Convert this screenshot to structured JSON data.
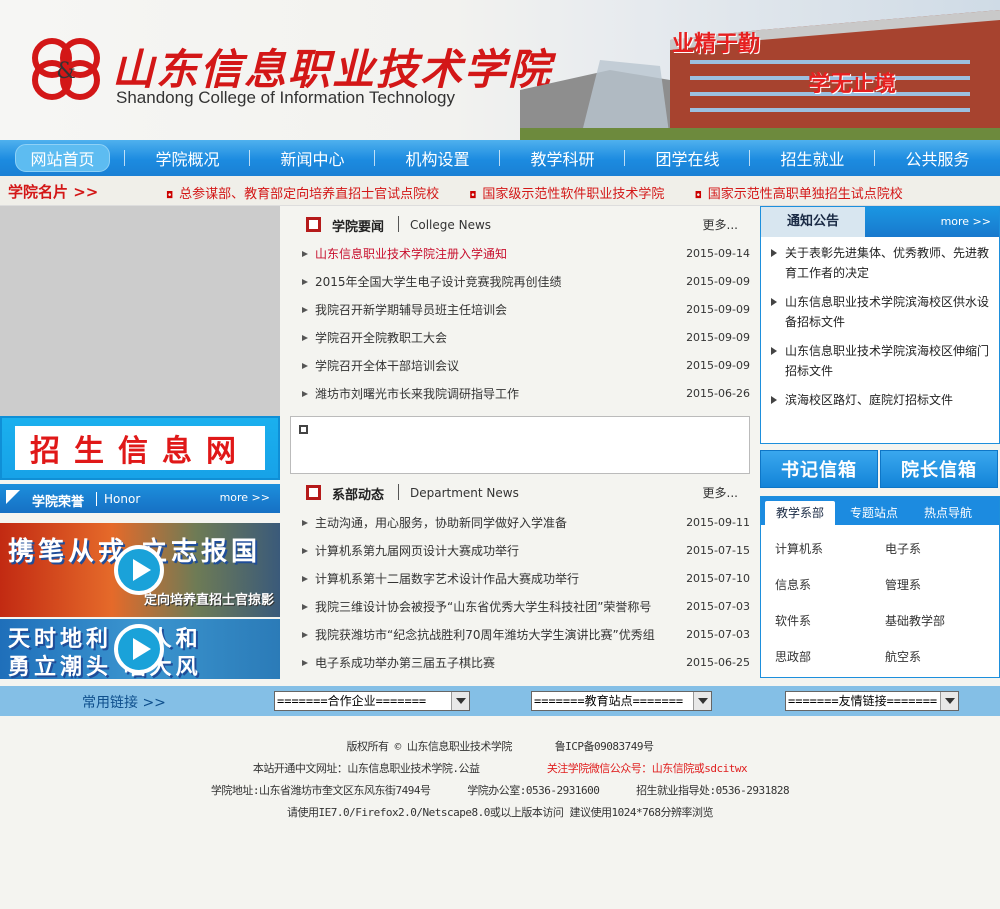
{
  "header": {
    "logo_cn": "山东信息职业技术学院",
    "logo_en": "Shandong College of Information Technology",
    "slogan_1": "业精于勤",
    "slogan_2": "学无止境"
  },
  "nav": {
    "items": [
      "网站首页",
      "学院概况",
      "新闻中心",
      "机构设置",
      "教学科研",
      "团学在线",
      "招生就业",
      "公共服务"
    ]
  },
  "namecard": {
    "title": "学院名片 >>",
    "items": [
      "总参谋部、教育部定向培养直招士官试点院校",
      "国家级示范性软件职业技术学院",
      "国家示范性高职单独招生试点院校"
    ]
  },
  "left": {
    "recruit_banner": "招生信息网",
    "honor": {
      "title": "学院荣誉",
      "subtitle": "Honor",
      "more": "more >>"
    },
    "video1": {
      "text": "携笔从戎 立志报国",
      "sub": "定向培养直招士官掠影"
    },
    "video2": {
      "text": "天时地利 共人和",
      "sub": "勇立潮头 唱大风"
    }
  },
  "college_news": {
    "title": "学院要闻",
    "subtitle": "College News",
    "more": "更多...",
    "items": [
      {
        "title": "山东信息职业技术学院注册入学通知",
        "date": "2015-09-14"
      },
      {
        "title": "2015年全国大学生电子设计竞赛我院再创佳绩",
        "date": "2015-09-09"
      },
      {
        "title": "我院召开新学期辅导员班主任培训会",
        "date": "2015-09-09"
      },
      {
        "title": "学院召开全院教职工大会",
        "date": "2015-09-09"
      },
      {
        "title": "学院召开全体干部培训会议",
        "date": "2015-09-09"
      },
      {
        "title": "潍坊市刘曙光市长来我院调研指导工作",
        "date": "2015-06-26"
      }
    ]
  },
  "dept_news": {
    "title": "系部动态",
    "subtitle": "Department News",
    "more": "更多...",
    "items": [
      {
        "title": "主动沟通，用心服务，协助新同学做好入学准备",
        "date": "2015-09-11"
      },
      {
        "title": "计算机系第九届网页设计大赛成功举行",
        "date": "2015-07-15"
      },
      {
        "title": "计算机系第十二届数字艺术设计作品大赛成功举行",
        "date": "2015-07-10"
      },
      {
        "title": "我院三维设计协会被授予“山东省优秀大学生科技社团”荣誉称号",
        "date": "2015-07-03"
      },
      {
        "title": "我院获潍坊市“纪念抗战胜利70周年潍坊大学生演讲比赛”优秀组",
        "date": "2015-07-03"
      },
      {
        "title": "电子系成功举办第三届五子棋比赛",
        "date": "2015-06-25"
      }
    ]
  },
  "notice": {
    "title": "通知公告",
    "more": "more >>",
    "items": [
      "关于表彰先进集体、优秀教师、先进教育工作者的决定",
      "山东信息职业技术学院滨海校区供水设备招标文件",
      "山东信息职业技术学院滨海校区伸缩门招标文件",
      "滨海校区路灯、庭院灯招标文件"
    ]
  },
  "buttons": {
    "guestbook": "书记信箱",
    "dean": "院长信箱"
  },
  "tabs": {
    "labels": [
      "教学系部",
      "专题站点",
      "热点导航"
    ],
    "departments": [
      "计算机系",
      "电子系",
      "信息系",
      "管理系",
      "软件系",
      "基础教学部",
      "思政部",
      "航空系"
    ]
  },
  "links_bar": {
    "label": "常用链接 >>",
    "select1": "=======合作企业=======",
    "select2": "=======教育站点=======",
    "select3": "=======友情链接======="
  },
  "footer": {
    "copyright": "版权所有 © 山东信息职业技术学院",
    "icp": "鲁ICP备09083749号",
    "cn_domain": "本站开通中文网址：山东信息职业技术学院.公益",
    "wechat": "关注学院微信公众号：山东信院或sdcitwx",
    "address": "学院地址:山东省潍坊市奎文区东风东街7494号",
    "office": "学院办公室:0536-2931600",
    "employment": "招生就业指导处:0536-2931828",
    "browser": "请使用IE7.0/Firefox2.0/Netscape8.0或以上版本访问 建议使用1024*768分辨率浏览"
  }
}
